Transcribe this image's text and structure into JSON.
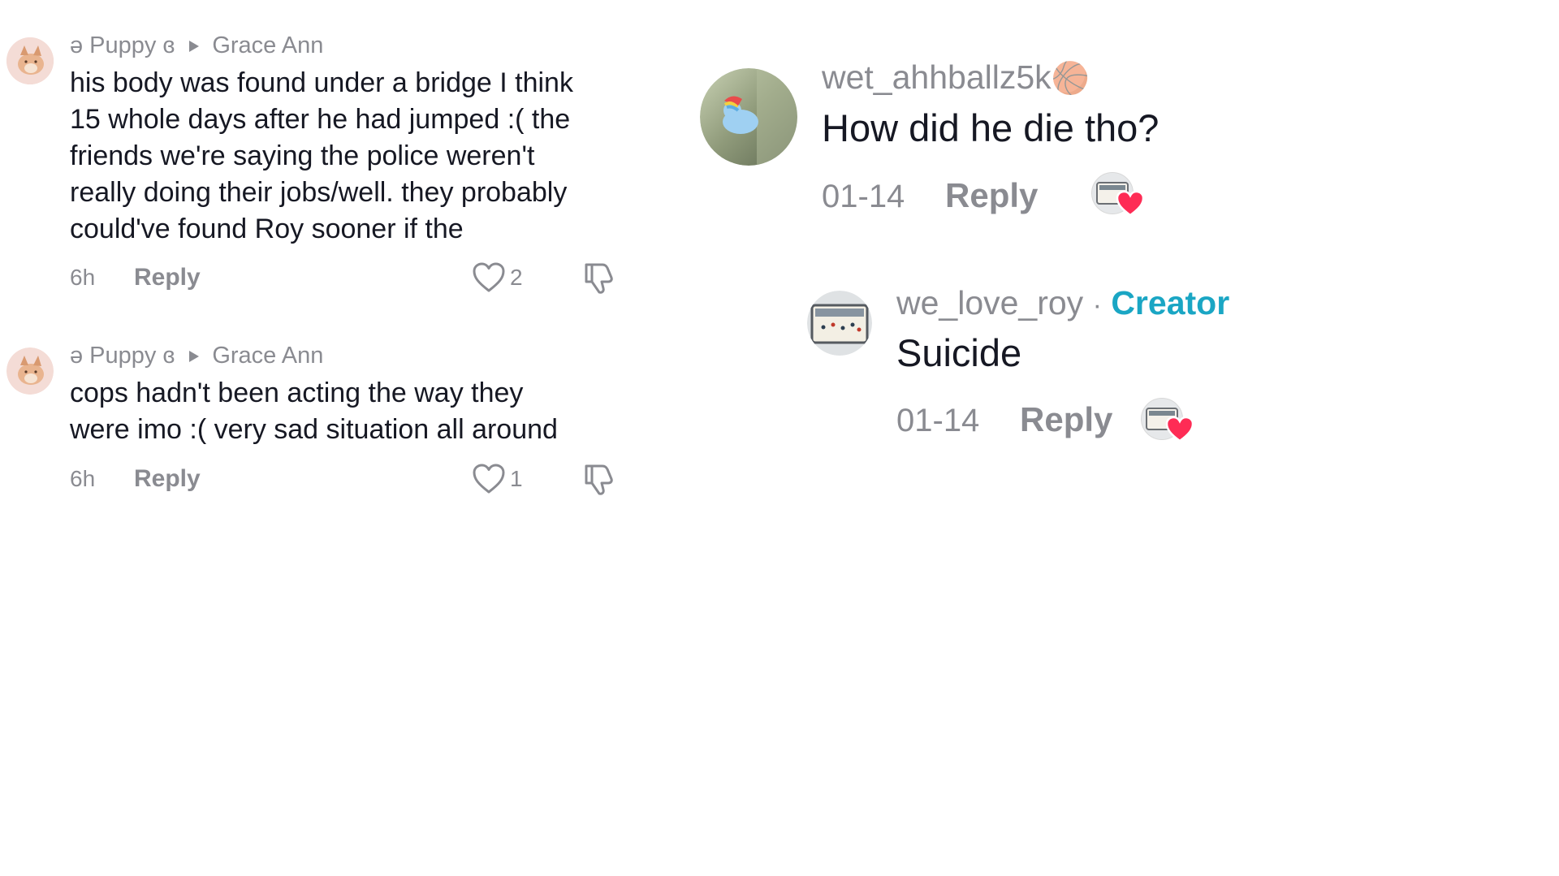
{
  "left_thread": {
    "comments": [
      {
        "author": "ə Puppy ɞ",
        "reply_to": "Grace Ann",
        "lines": [
          "his body was found under a bridge I think",
          "15 whole days after he had jumped :( the",
          "friends we're saying the police weren't",
          "really doing their jobs/well. they probably",
          "could've found Roy sooner if the"
        ],
        "time": "6h",
        "reply_label": "Reply",
        "likes": "2"
      },
      {
        "author": "ə Puppy ɞ",
        "reply_to": "Grace Ann",
        "lines": [
          "cops hadn't been acting the way they",
          "were imo :( very sad situation all around"
        ],
        "time": "6h",
        "reply_label": "Reply",
        "likes": "1"
      }
    ]
  },
  "right_thread": {
    "comment": {
      "author": "wet_ahhballz5k",
      "author_emoji": "🏀",
      "text": "How did he die tho?",
      "date": "01-14",
      "reply_label": "Reply"
    },
    "reply": {
      "author": "we_love_roy",
      "separator": "·",
      "badge": "Creator",
      "text": "Suicide",
      "date": "01-14",
      "reply_label": "Reply"
    }
  },
  "colors": {
    "meta_gray": "#8a8b91",
    "text": "#161823",
    "creator_badge": "#1aa6c4",
    "heart_red": "#fe2c55"
  },
  "icons": [
    "play-arrow-icon",
    "heart-outline-icon",
    "thumbs-down-icon",
    "creator-liked-heart-icon",
    "basketball-emoji-icon"
  ]
}
